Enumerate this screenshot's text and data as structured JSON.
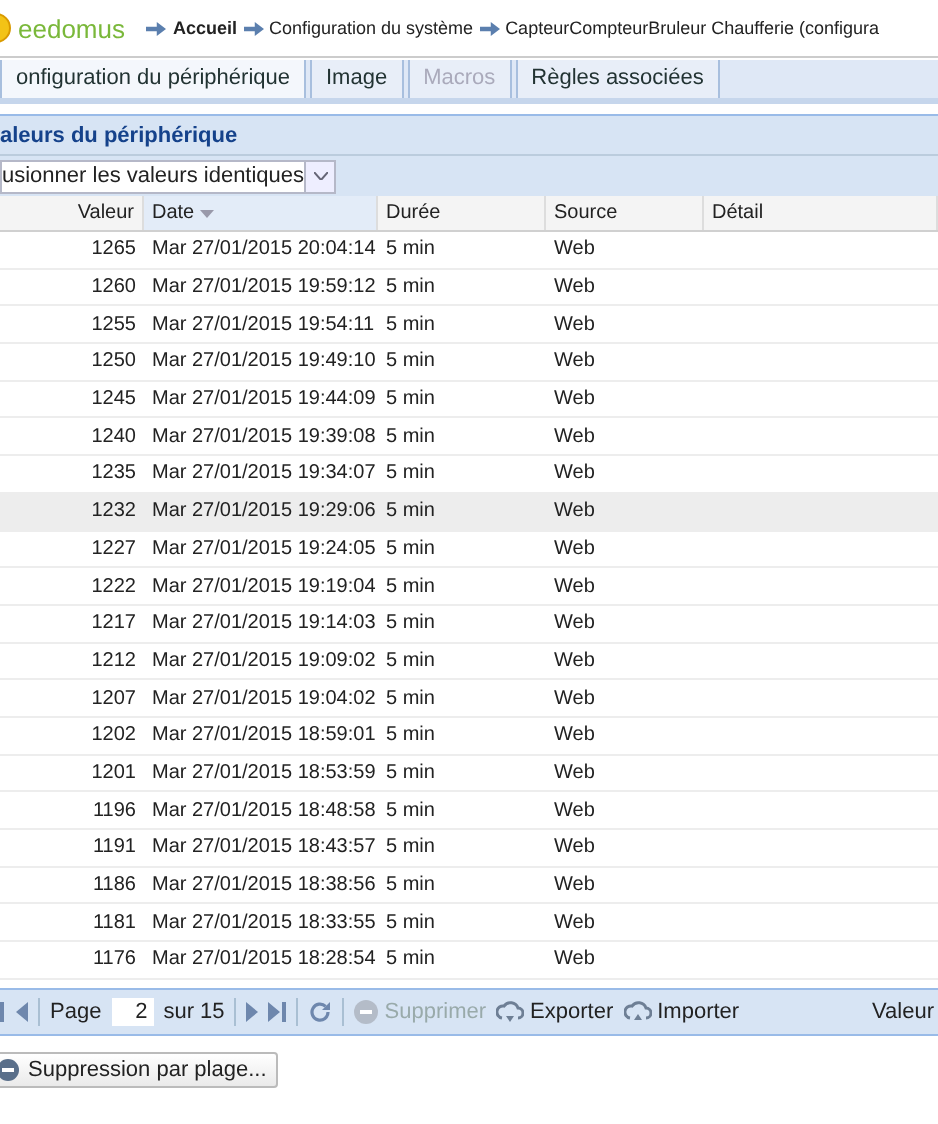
{
  "header": {
    "logo": "eedomus",
    "breadcrumb": [
      {
        "label": "Accueil",
        "current": true
      },
      {
        "label": "Configuration du système",
        "current": false
      },
      {
        "label": "CapteurCompteurBruleur Chaufferie (configura",
        "current": false
      }
    ]
  },
  "tabs": [
    {
      "label": "onfiguration du périphérique",
      "selected": true,
      "disabled": false
    },
    {
      "label": "Image",
      "selected": false,
      "disabled": false
    },
    {
      "label": "Macros",
      "selected": false,
      "disabled": true
    },
    {
      "label": "Règles associées",
      "selected": false,
      "disabled": false
    }
  ],
  "panel": {
    "title": "aleurs du périphérique",
    "filter": "usionner les valeurs identiques"
  },
  "table": {
    "columns": [
      {
        "label": "Valeur",
        "sorted": false
      },
      {
        "label": "Date",
        "sorted": true
      },
      {
        "label": "Durée",
        "sorted": false
      },
      {
        "label": "Source",
        "sorted": false
      },
      {
        "label": "Détail",
        "sorted": false
      }
    ],
    "rows": [
      {
        "value": "1265",
        "date": "Mar 27/01/2015 20:04:14",
        "duration": "5 min",
        "source": "Web",
        "selected": false
      },
      {
        "value": "1260",
        "date": "Mar 27/01/2015 19:59:12",
        "duration": "5 min",
        "source": "Web",
        "selected": false
      },
      {
        "value": "1255",
        "date": "Mar 27/01/2015 19:54:11",
        "duration": "5 min",
        "source": "Web",
        "selected": false
      },
      {
        "value": "1250",
        "date": "Mar 27/01/2015 19:49:10",
        "duration": "5 min",
        "source": "Web",
        "selected": false
      },
      {
        "value": "1245",
        "date": "Mar 27/01/2015 19:44:09",
        "duration": "5 min",
        "source": "Web",
        "selected": false
      },
      {
        "value": "1240",
        "date": "Mar 27/01/2015 19:39:08",
        "duration": "5 min",
        "source": "Web",
        "selected": false
      },
      {
        "value": "1235",
        "date": "Mar 27/01/2015 19:34:07",
        "duration": "5 min",
        "source": "Web",
        "selected": false
      },
      {
        "value": "1232",
        "date": "Mar 27/01/2015 19:29:06",
        "duration": "5 min",
        "source": "Web",
        "selected": true
      },
      {
        "value": "1227",
        "date": "Mar 27/01/2015 19:24:05",
        "duration": "5 min",
        "source": "Web",
        "selected": false
      },
      {
        "value": "1222",
        "date": "Mar 27/01/2015 19:19:04",
        "duration": "5 min",
        "source": "Web",
        "selected": false
      },
      {
        "value": "1217",
        "date": "Mar 27/01/2015 19:14:03",
        "duration": "5 min",
        "source": "Web",
        "selected": false
      },
      {
        "value": "1212",
        "date": "Mar 27/01/2015 19:09:02",
        "duration": "5 min",
        "source": "Web",
        "selected": false
      },
      {
        "value": "1207",
        "date": "Mar 27/01/2015 19:04:02",
        "duration": "5 min",
        "source": "Web",
        "selected": false
      },
      {
        "value": "1202",
        "date": "Mar 27/01/2015 18:59:01",
        "duration": "5 min",
        "source": "Web",
        "selected": false
      },
      {
        "value": "1201",
        "date": "Mar 27/01/2015 18:53:59",
        "duration": "5 min",
        "source": "Web",
        "selected": false
      },
      {
        "value": "1196",
        "date": "Mar 27/01/2015 18:48:58",
        "duration": "5 min",
        "source": "Web",
        "selected": false
      },
      {
        "value": "1191",
        "date": "Mar 27/01/2015 18:43:57",
        "duration": "5 min",
        "source": "Web",
        "selected": false
      },
      {
        "value": "1186",
        "date": "Mar 27/01/2015 18:38:56",
        "duration": "5 min",
        "source": "Web",
        "selected": false
      },
      {
        "value": "1181",
        "date": "Mar 27/01/2015 18:33:55",
        "duration": "5 min",
        "source": "Web",
        "selected": false
      },
      {
        "value": "1176",
        "date": "Mar 27/01/2015 18:28:54",
        "duration": "5 min",
        "source": "Web",
        "selected": false
      }
    ]
  },
  "pager": {
    "page_label": "Page",
    "page": "2",
    "total": "sur 15",
    "actions": [
      {
        "label": "Supprimer",
        "disabled": true,
        "kind": "delete"
      },
      {
        "label": "Exporter",
        "disabled": false,
        "kind": "export"
      },
      {
        "label": "Importer",
        "disabled": false,
        "kind": "import"
      }
    ],
    "right_label": "Valeur"
  },
  "range_button": "Suppression par plage..."
}
